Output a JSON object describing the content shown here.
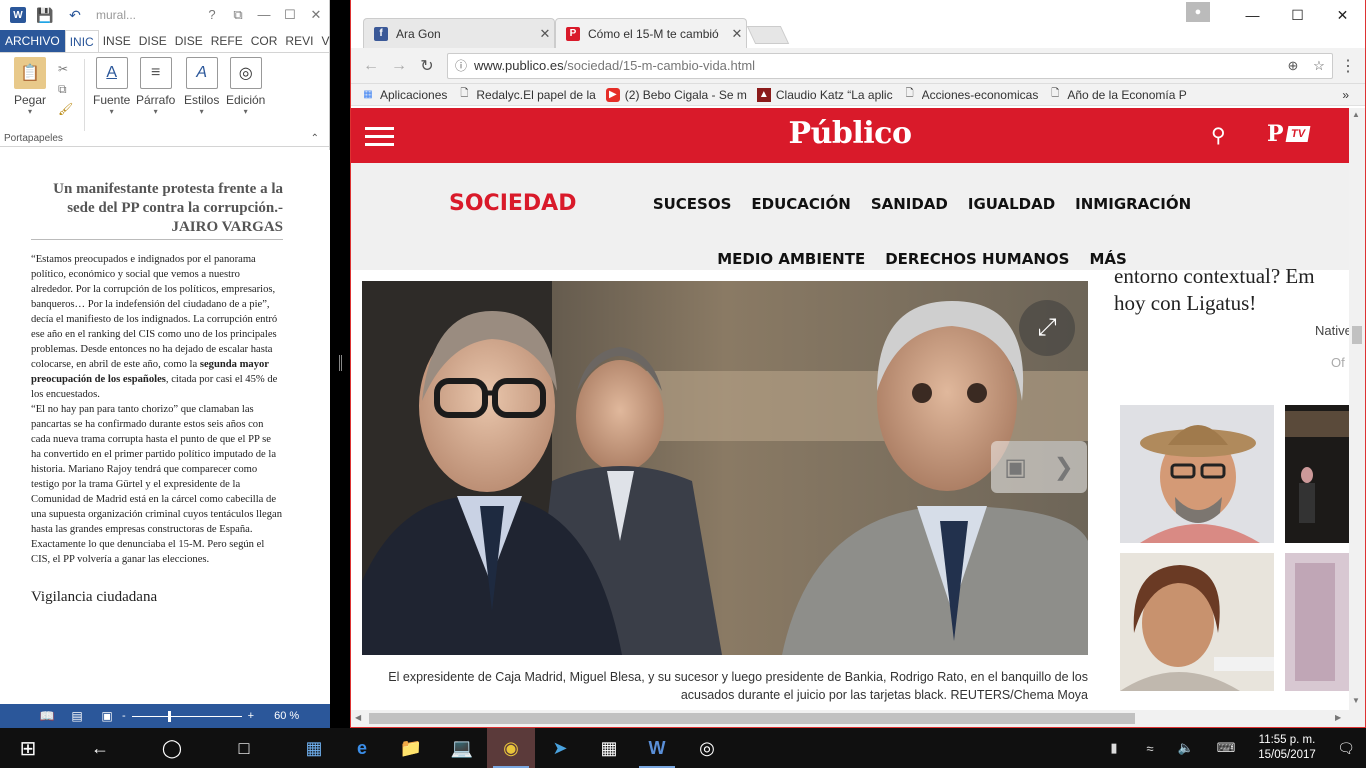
{
  "word": {
    "title_doc": "mural...",
    "title_controls": [
      "?",
      "⧉",
      "—",
      "☐",
      "✕"
    ],
    "tabs": [
      "ARCHIVO",
      "INIC",
      "INSE",
      "DISE",
      "DISE",
      "REFE",
      "COR",
      "REVI",
      "VI"
    ],
    "ribbon": {
      "paste": "Pegar",
      "font": "Fuente",
      "paragraph": "Párrafo",
      "styles": "Estilos",
      "editing": "Edición",
      "clipboard_group": "Portapapeles"
    },
    "doc": {
      "heading": "Un manifestante protesta frente a la sede del PP contra la corrupción.- JAIRO VARGAS",
      "para1_before": "“Estamos preocupados e indignados por el panorama político, económico y social que vemos a nuestro alrededor. Por la corrupción de los políticos, empresarios, banqueros… Por la indefensión del ciudadano de a pie”, decía el manifiesto de los indignados. La corrupción entró ese año en el ranking del CIS como uno de los principales problemas. Desde entonces no ha dejado de escalar hasta colocarse, en abril de este año, como la ",
      "para1_bold": "segunda mayor preocupación de los españoles",
      "para1_after": ", citada por casi el 45% de los encuestados.",
      "para2": "“El no hay pan para tanto chorizo” que clamaban las pancartas se ha confirmado durante estos seis años con cada nueva trama corrupta hasta el punto de que el PP se ha convertido en el primer partido político imputado de la historia. Mariano Rajoy tendrá que comparecer como testigo por la trama Gürtel y el expresidente de la Comunidad de Madrid está en la cárcel como cabecilla de una supuesta organización criminal cuyos tentáculos llegan hasta las grandes empresas constructoras de España. Exactamente lo que denunciaba el 15-M. Pero según el CIS, el PP volvería a ganar las elecciones.",
      "subheading": "Vigilancia ciudadana"
    },
    "status": {
      "zoom": "60 %",
      "zoom_minus": "-",
      "zoom_plus": "+"
    }
  },
  "browser": {
    "tabs": [
      {
        "title": "Ara Gon",
        "favicon": "f"
      },
      {
        "title": "Cómo el 15-M te cambió",
        "favicon": "P"
      }
    ],
    "url_host": "www.publico.es",
    "url_path": "/sociedad/15-m-cambio-vida.html",
    "bookmarks": [
      {
        "label": "Aplicaciones",
        "icon": "grid-icon"
      },
      {
        "label": "Redalyc.El papel de la",
        "icon": "page-icon"
      },
      {
        "label": "(2) Bebo Cigala - Se m",
        "icon": "youtube-icon"
      },
      {
        "label": "Claudio Katz “La aplic",
        "icon": "pdf-icon"
      },
      {
        "label": "Acciones-economicas",
        "icon": "page-icon"
      },
      {
        "label": "Año de la Economía P",
        "icon": "page-icon"
      }
    ],
    "bookmarks_more": "»",
    "site": {
      "logo": "Público",
      "tv_p": "P",
      "tv_label": "TV",
      "section": "SOCIEDAD",
      "nav": [
        "SUCESOS",
        "EDUCACIÓN",
        "SANIDAD",
        "IGUALDAD",
        "INMIGRACIÓN",
        "MEDIO AMBIENTE",
        "DERECHOS HUMANOS",
        "MÁS"
      ],
      "caption": "El expresidente de Caja Madrid, Miguel Blesa, y su sucesor y luego presidente de Bankia, Rodrigo Rato, en el banquillo de los acusados durante el juicio por las tarjetas black. REUTERS/Chema Moya",
      "ad_line1": "entorno contextual? Em",
      "ad_line2": "hoy con Ligatus!",
      "ad_native": "Native",
      "ad_of": "Of"
    }
  },
  "taskbar": {
    "time": "11:55 p. m.",
    "date": "15/05/2017"
  }
}
